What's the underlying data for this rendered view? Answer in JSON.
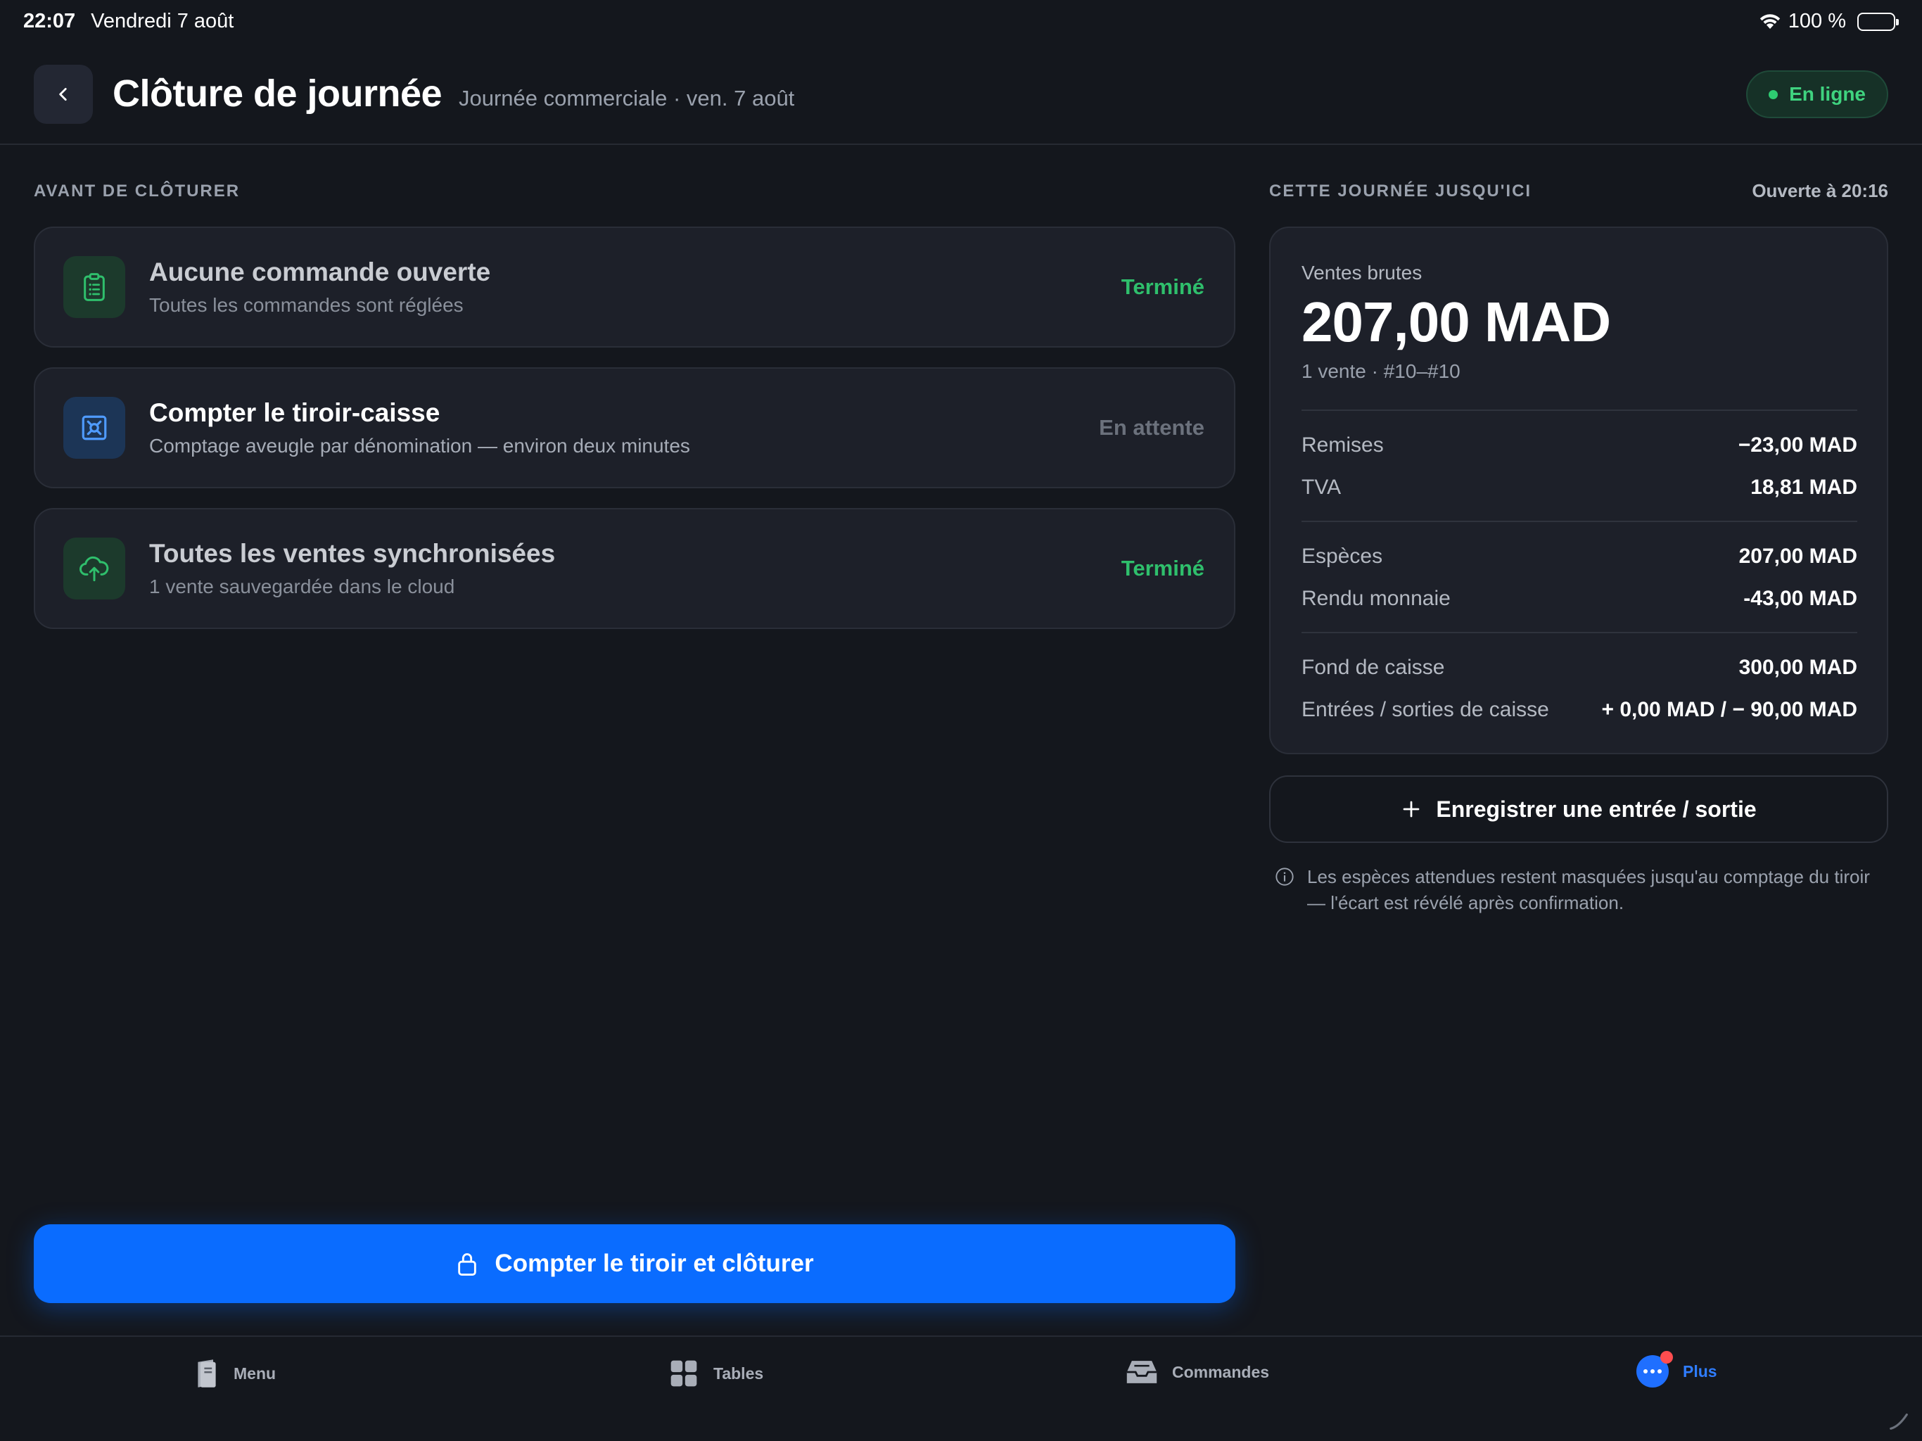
{
  "status_bar": {
    "time": "22:07",
    "date": "Vendredi 7 août",
    "battery": "100 %",
    "icons": [
      "wifi-icon",
      "battery-icon"
    ]
  },
  "header": {
    "title": "Clôture de journée",
    "subtitle": "Journée commerciale · ven. 7 août",
    "status_badge": "En ligne",
    "back_icon": "chevron-left-icon"
  },
  "checklist": {
    "section_label": "AVANT DE CLÔTURER",
    "items": [
      {
        "title": "Aucune commande ouverte",
        "description": "Toutes les commandes sont réglées",
        "status": "Terminé",
        "icon": "clipboard-list-icon"
      },
      {
        "title": "Compter le tiroir-caisse",
        "description": "Comptage aveugle par dénomination — environ deux minutes",
        "status": "En attente",
        "icon": "safe-icon"
      },
      {
        "title": "Toutes les ventes synchronisées",
        "description": "1 vente sauvegardée dans le cloud",
        "status": "Terminé",
        "icon": "cloud-upload-icon"
      }
    ]
  },
  "summary": {
    "section_label": "CETTE JOURNÉE JUSQU'ICI",
    "opened_at": "Ouverte à 20:16",
    "gross_label": "Ventes brutes",
    "gross_value": "207,00 MAD",
    "gross_sub": "1 vente · #10–#10",
    "rows": [
      {
        "label": "Remises",
        "value": "−23,00 MAD"
      },
      {
        "label": "TVA",
        "value": "18,81 MAD"
      },
      {
        "label": "Espèces",
        "value": "207,00 MAD"
      },
      {
        "label": "Rendu monnaie",
        "value": "-43,00 MAD"
      },
      {
        "label": "Fond de caisse",
        "value": "300,00 MAD"
      },
      {
        "label": "Entrées / sorties de caisse",
        "value": "+ 0,00 MAD / − 90,00 MAD"
      }
    ],
    "record_button": "Enregistrer une entrée / sortie",
    "info_note": "Les espèces attendues restent masquées jusqu'au comptage du tiroir — l'écart est révélé après confirmation."
  },
  "primary_action": {
    "label": "Compter le tiroir et clôturer",
    "icon": "lock-icon"
  },
  "tab_bar": {
    "tabs": [
      {
        "label": "Menu",
        "icon": "menu-book-icon"
      },
      {
        "label": "Tables",
        "icon": "grid-icon"
      },
      {
        "label": "Commandes",
        "icon": "inbox-tray-icon"
      },
      {
        "label": "Plus",
        "icon": "more-icon",
        "active": true
      }
    ]
  },
  "colors": {
    "background": "#14171d",
    "card": "#1d2029",
    "accent": "#0a6cff",
    "success": "#2fbf6c",
    "pending": "#6b717c"
  }
}
